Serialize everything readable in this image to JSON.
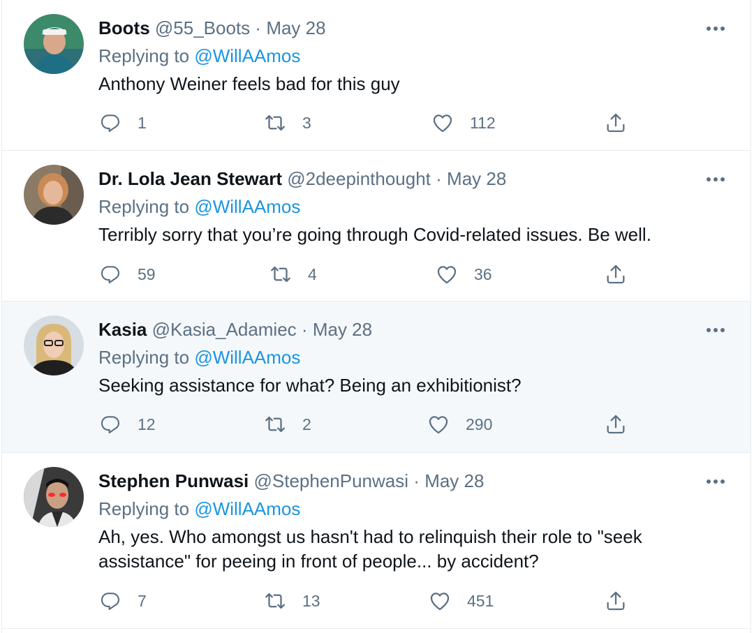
{
  "colors": {
    "link": "#1b95e0",
    "secondary_text": "#5b7083",
    "primary_text": "#0f1419",
    "divider": "#e6ecf0",
    "hover_bg": "#f5f8fa"
  },
  "tweets": [
    {
      "name": "Boots",
      "handle": "@55_Boots",
      "separator": "·",
      "date": "May 28",
      "replying_prefix": "Replying to ",
      "replying_to": "@WillAAmos",
      "text": "Anthony Weiner feels bad for this guy",
      "replies": "1",
      "retweets": "3",
      "likes": "112"
    },
    {
      "name": "Dr. Lola Jean Stewart",
      "handle": "@2deepinthought",
      "separator": "·",
      "date": "May 28",
      "replying_prefix": "Replying to ",
      "replying_to": "@WillAAmos",
      "text": "Terribly sorry that you’re going through Covid-related issues. Be well.",
      "replies": "59",
      "retweets": "4",
      "likes": "36"
    },
    {
      "name": "Kasia",
      "handle": "@Kasia_Adamiec",
      "separator": "·",
      "date": "May 28",
      "replying_prefix": "Replying to ",
      "replying_to": "@WillAAmos",
      "text": "Seeking assistance for what? Being an exhibitionist?",
      "replies": "12",
      "retweets": "2",
      "likes": "290"
    },
    {
      "name": "Stephen Punwasi",
      "handle": "@StephenPunwasi",
      "separator": "·",
      "date": "May 28",
      "replying_prefix": "Replying to ",
      "replying_to": "@WillAAmos",
      "text": "Ah, yes. Who amongst us hasn't had to relinquish their role to \"seek assistance\" for peeing in front of people... by accident?",
      "replies": "7",
      "retweets": "13",
      "likes": "451"
    }
  ],
  "icons": {
    "reply": "reply-icon",
    "retweet": "retweet-icon",
    "like": "heart-icon",
    "share": "share-icon",
    "more": "more-icon"
  }
}
